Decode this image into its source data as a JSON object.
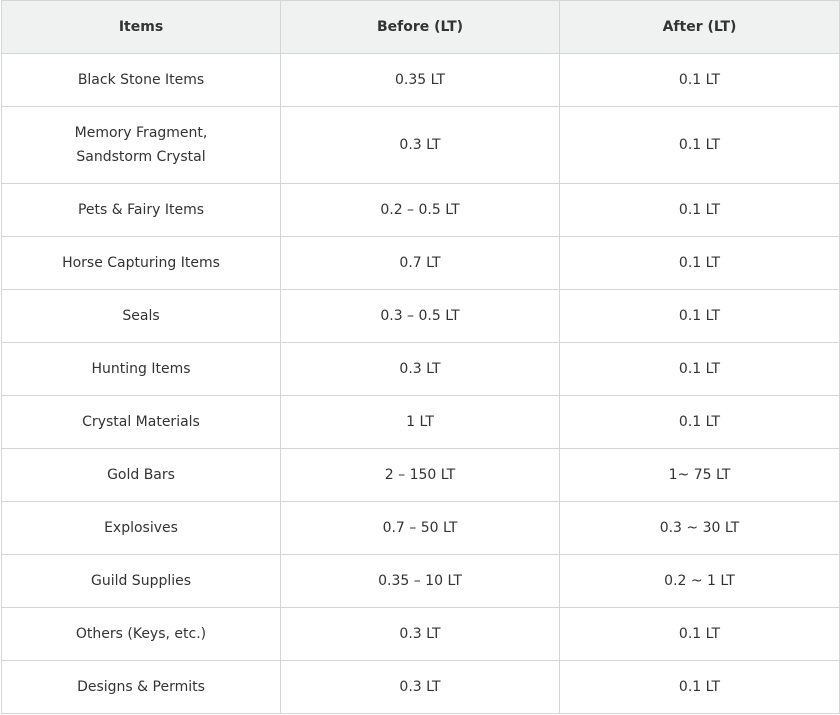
{
  "table": {
    "headers": [
      "Items",
      "Before (LT)",
      "After (LT)"
    ],
    "rows": [
      {
        "item": [
          "Black Stone Items"
        ],
        "before": "0.35 LT",
        "after": "0.1 LT"
      },
      {
        "item": [
          "Memory Fragment,",
          "Sandstorm Crystal"
        ],
        "before": "0.3 LT",
        "after": "0.1 LT"
      },
      {
        "item": [
          "Pets & Fairy Items"
        ],
        "before": "0.2 – 0.5 LT",
        "after": "0.1 LT"
      },
      {
        "item": [
          "Horse Capturing Items"
        ],
        "before": "0.7 LT",
        "after": "0.1 LT"
      },
      {
        "item": [
          "Seals"
        ],
        "before": "0.3 – 0.5 LT",
        "after": "0.1 LT"
      },
      {
        "item": [
          "Hunting Items"
        ],
        "before": "0.3 LT",
        "after": "0.1 LT"
      },
      {
        "item": [
          "Crystal Materials"
        ],
        "before": "1 LT",
        "after": "0.1 LT"
      },
      {
        "item": [
          "Gold Bars"
        ],
        "before": "2 – 150 LT",
        "after": "1~ 75 LT"
      },
      {
        "item": [
          "Explosives"
        ],
        "before": "0.7 – 50 LT",
        "after": "0.3 ~ 30 LT"
      },
      {
        "item": [
          "Guild Supplies"
        ],
        "before": "0.35 – 10 LT",
        "after": "0.2 ~ 1 LT"
      },
      {
        "item": [
          "Others (Keys, etc.)"
        ],
        "before": "0.3 LT",
        "after": "0.1 LT"
      },
      {
        "item": [
          "Designs & Permits"
        ],
        "before": "0.3 LT",
        "after": "0.1 LT"
      }
    ]
  }
}
